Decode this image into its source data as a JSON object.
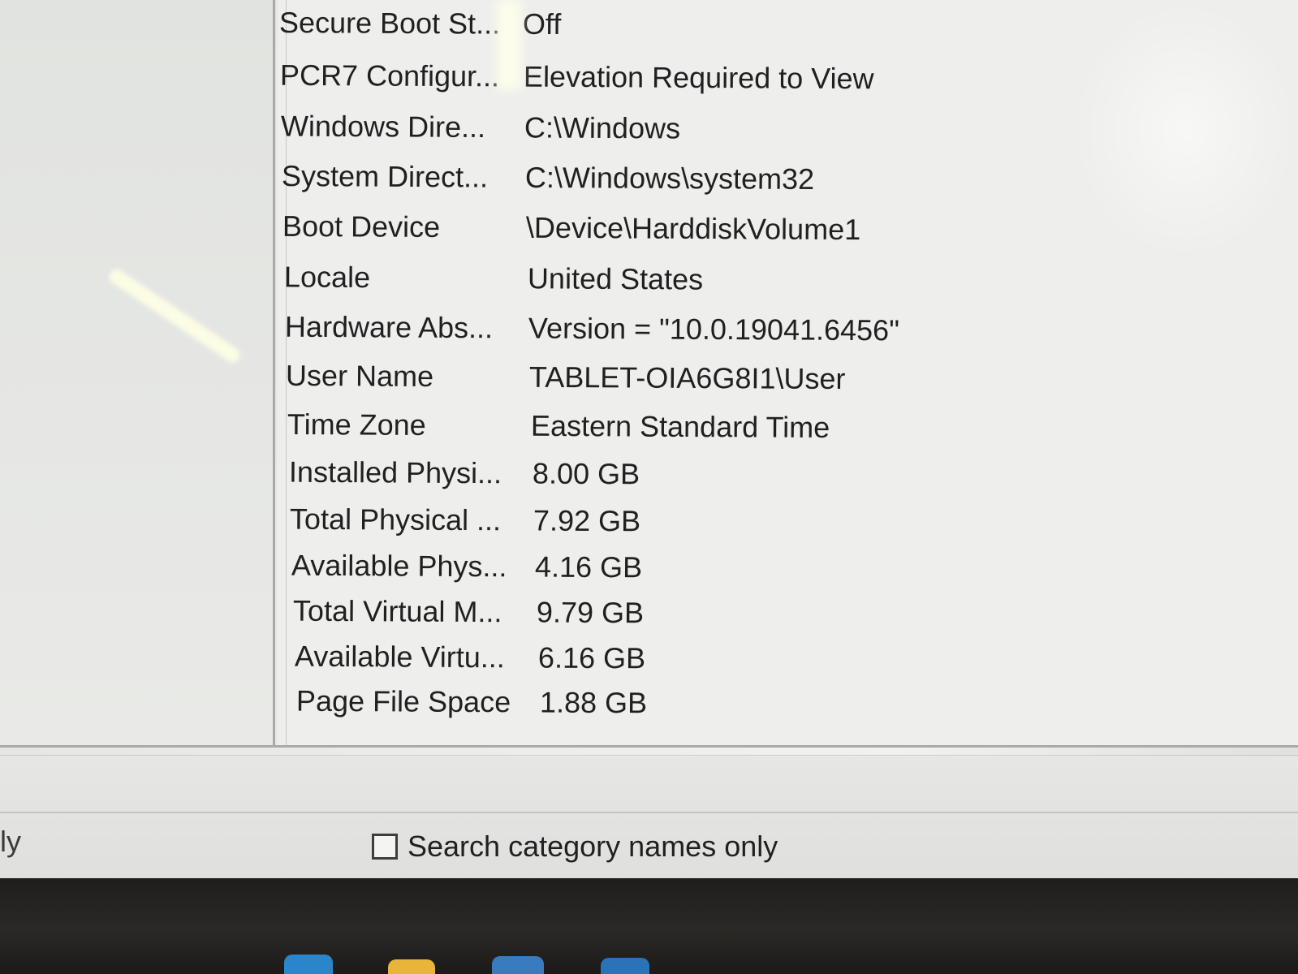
{
  "system_summary": {
    "rows": [
      {
        "item": "Secure Boot St...",
        "value": "Off"
      },
      {
        "item": "PCR7 Configur...",
        "value": "Elevation Required to View"
      },
      {
        "item": "Windows Dire...",
        "value": "C:\\Windows"
      },
      {
        "item": "System Direct...",
        "value": "C:\\Windows\\system32"
      },
      {
        "item": "Boot Device",
        "value": "\\Device\\HarddiskVolume1"
      },
      {
        "item": "Locale",
        "value": "United States"
      },
      {
        "item": "Hardware Abs...",
        "value": "Version = \"10.0.19041.6456\""
      },
      {
        "item": "User Name",
        "value": "TABLET-OIA6G8I1\\User"
      },
      {
        "item": "Time Zone",
        "value": "Eastern Standard Time"
      },
      {
        "item": "Installed Physi...",
        "value": "8.00 GB"
      },
      {
        "item": "Total Physical ...",
        "value": "7.92 GB"
      },
      {
        "item": "Available Phys...",
        "value": "4.16 GB"
      },
      {
        "item": "Total Virtual M...",
        "value": "9.79 GB"
      },
      {
        "item": "Available Virtu...",
        "value": "6.16 GB"
      },
      {
        "item": "Page File Space",
        "value": "1.88 GB"
      }
    ]
  },
  "search": {
    "left_fragment": "ly",
    "category_only_label": "Search category names only",
    "category_only_checked": false
  },
  "colors": {
    "panel_background": "#eeefec",
    "text": "#1f2020",
    "taskbar": "#24231f"
  },
  "taskbar_icons": [
    "edge-icon",
    "file-explorer-icon",
    "store-icon",
    "app-icon"
  ]
}
